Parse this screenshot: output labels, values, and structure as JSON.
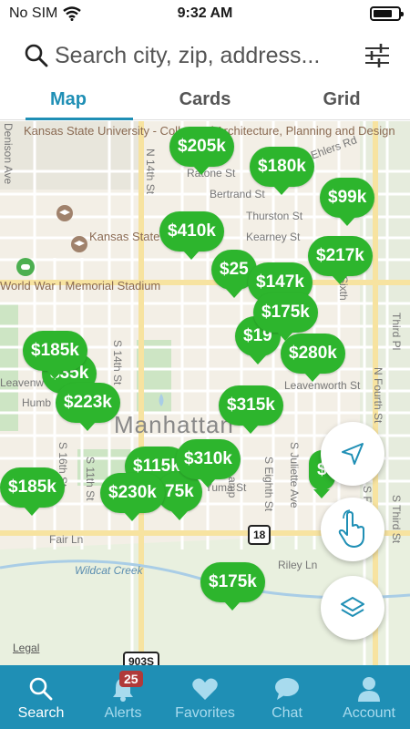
{
  "status": {
    "carrier": "No SIM",
    "time": "9:32 AM"
  },
  "search": {
    "placeholder": "Search city, zip, address..."
  },
  "tabs": [
    {
      "label": "Map"
    },
    {
      "label": "Cards"
    },
    {
      "label": "Grid"
    }
  ],
  "map": {
    "labels": {
      "campus": "Kansas State University - College of Architecture, Planning and Design",
      "university": "Kansas State University",
      "stadium": "World War I Memorial Stadium",
      "city": "Manhattan",
      "creek": "Wildcat Creek",
      "legal": "Legal",
      "shield_18": "18",
      "shield_903s": "903S",
      "streets": {
        "denison": "Denison Ave",
        "ehlers": "Ehlers Rd",
        "ratone": "Ratone St",
        "bertrand": "Bertrand St",
        "thurston": "Thurston St",
        "kearney": "Kearney St",
        "leavenworth": "Leavenworth St",
        "leaven": "Leavenw",
        "humb": "Humb",
        "fair": "Fair Ln",
        "riley": "Riley Ln",
        "yuma": "Yuma St",
        "n14": "N 14th St",
        "s14": "S 14th St",
        "s16": "S 16th St",
        "s11": "S 11th St",
        "s8": "S Eighth St",
        "sjul": "S Juliette Ave",
        "nfourth": "N Fourth St",
        "third": "Third Pl",
        "sixth": "Sixth",
        "s5": "S Fifth St",
        "sthird": "S Third St",
        "n": "N",
        "amp": "amp"
      }
    },
    "pins": [
      {
        "price": "$205k"
      },
      {
        "price": "$180k"
      },
      {
        "price": "$99k"
      },
      {
        "price": "$410k"
      },
      {
        "price": "$25"
      },
      {
        "price": "$147k"
      },
      {
        "price": "$217k"
      },
      {
        "price": "$175k"
      },
      {
        "price": "$19"
      },
      {
        "price": "$280k"
      },
      {
        "price": "$185k"
      },
      {
        "price": "$35k"
      },
      {
        "price": "$223k"
      },
      {
        "price": "$315k"
      },
      {
        "price": "$115k"
      },
      {
        "price": "$310k"
      },
      {
        "price": "$230k"
      },
      {
        "price": "75k"
      },
      {
        "price": "$185k"
      },
      {
        "price": "$"
      },
      {
        "price": "$175k"
      }
    ]
  },
  "nav": [
    {
      "label": "Search",
      "icon": "search-icon"
    },
    {
      "label": "Alerts",
      "icon": "bell-icon",
      "badge": "25"
    },
    {
      "label": "Favorites",
      "icon": "heart-icon"
    },
    {
      "label": "Chat",
      "icon": "chat-bubble-icon"
    },
    {
      "label": "Account",
      "icon": "person-icon"
    }
  ],
  "colors": {
    "accent": "#1f8fb5",
    "pin": "#2db52d",
    "badge": "#b03a3a"
  }
}
